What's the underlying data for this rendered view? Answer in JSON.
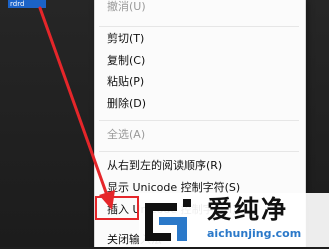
{
  "selected_text": "rdrd",
  "menu": {
    "undo": "撤消(U)",
    "cut": "剪切(T)",
    "copy": "复制(C)",
    "paste": "粘贴(P)",
    "delete": "删除(D)",
    "select_all": "全选(A)",
    "rtl": "从右到左的阅读顺序(R)",
    "show_unicode": "显示 Unicode 控制字符(S)",
    "insert_unicode": "插入 Unicode 控制字符(I)",
    "close_ime": "关闭输入法"
  },
  "watermark": {
    "title": "爱纯净",
    "url": "aichunjing.com"
  },
  "colors": {
    "annotation": "#e5262a",
    "brand_blue": "#2b79c9"
  }
}
